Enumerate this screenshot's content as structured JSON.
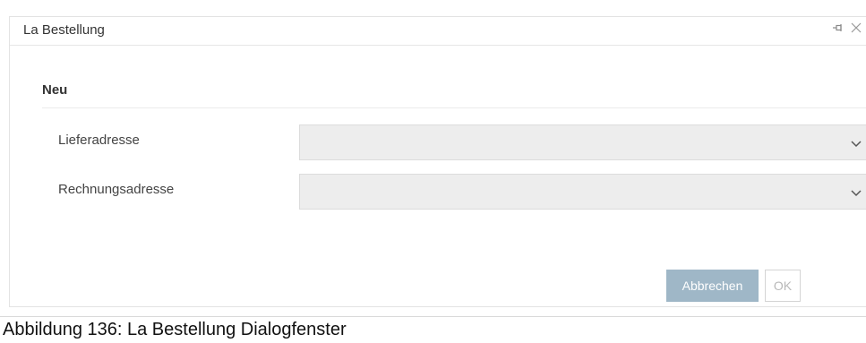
{
  "dialog": {
    "title": "La Bestellung",
    "section_title": "Neu",
    "fields": [
      {
        "label": "Lieferadresse",
        "value": ""
      },
      {
        "label": "Rechnungsadresse",
        "value": ""
      }
    ],
    "buttons": {
      "cancel_label": "Abbrechen",
      "ok_label": "OK"
    },
    "colors": {
      "cancel_button_bg": "#9fb7c7",
      "select_bg": "#ededed"
    },
    "icons": [
      "pin-icon",
      "close-icon",
      "chevron-down-icon"
    ]
  },
  "caption": "Abbildung 136: La Bestellung Dialogfenster"
}
